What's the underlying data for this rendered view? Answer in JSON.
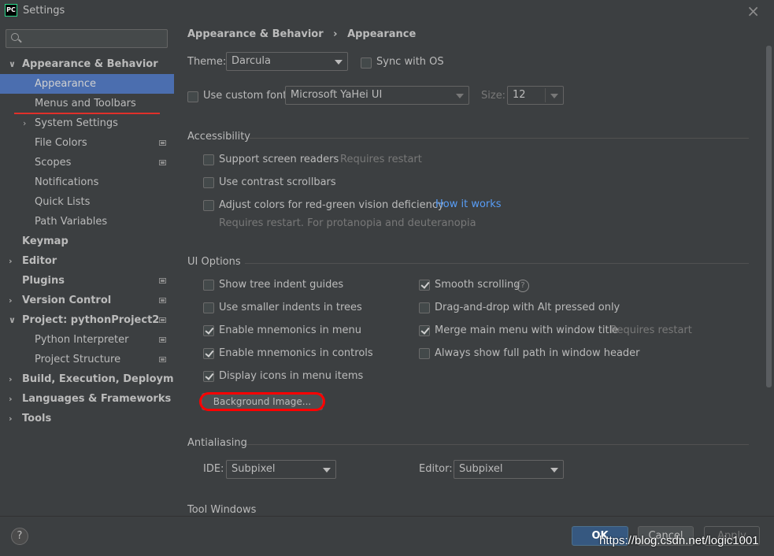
{
  "window": {
    "title": "Settings",
    "close_symbol": "×",
    "app_icon_text": "PC"
  },
  "sidebar": {
    "search_placeholder": "",
    "items": [
      {
        "label": "Appearance & Behavior",
        "expanded": true,
        "arrow": "∨"
      },
      {
        "label": "Appearance"
      },
      {
        "label": "Menus and Toolbars"
      },
      {
        "label": "System Settings",
        "arrow": "›"
      },
      {
        "label": "File Colors"
      },
      {
        "label": "Scopes"
      },
      {
        "label": "Notifications"
      },
      {
        "label": "Quick Lists"
      },
      {
        "label": "Path Variables"
      },
      {
        "label": "Keymap"
      },
      {
        "label": "Editor",
        "arrow": "›"
      },
      {
        "label": "Plugins"
      },
      {
        "label": "Version Control",
        "arrow": "›"
      },
      {
        "label": "Project: pythonProject2",
        "arrow": "∨"
      },
      {
        "label": "Python Interpreter"
      },
      {
        "label": "Project Structure"
      },
      {
        "label": "Build, Execution, Deployment",
        "arrow": "›"
      },
      {
        "label": "Languages & Frameworks",
        "arrow": "›"
      },
      {
        "label": "Tools",
        "arrow": "›"
      }
    ]
  },
  "breadcrumb": {
    "parent": "Appearance & Behavior",
    "separator": "›",
    "current": "Appearance"
  },
  "theme": {
    "label": "Theme:",
    "value": "Darcula",
    "sync_label": "Sync with OS",
    "sync_checked": false
  },
  "font": {
    "custom_label": "Use custom font:",
    "custom_checked": false,
    "family": "Microsoft YaHei UI",
    "size_label": "Size:",
    "size": "12"
  },
  "accessibility": {
    "title": "Accessibility",
    "screen_readers": "Support screen readers",
    "screen_readers_note": "Requires restart",
    "contrast_scrollbars": "Use contrast scrollbars",
    "color_deficiency": "Adjust colors for red-green vision deficiency",
    "how_it_works": "How it works",
    "deficiency_note": "Requires restart. For protanopia and deuteranopia"
  },
  "ui_options": {
    "title": "UI Options",
    "left": [
      {
        "label": "Show tree indent guides",
        "checked": false
      },
      {
        "label": "Use smaller indents in trees",
        "checked": false
      },
      {
        "label": "Enable mnemonics in menu",
        "checked": true
      },
      {
        "label": "Enable mnemonics in controls",
        "checked": true
      },
      {
        "label": "Display icons in menu items",
        "checked": true
      }
    ],
    "right": [
      {
        "label": "Smooth scrolling",
        "checked": true
      },
      {
        "label": "Drag-and-drop with Alt pressed only",
        "checked": false
      },
      {
        "label": "Merge main menu with window title",
        "checked": true
      },
      {
        "label": "Always show full path in window header",
        "checked": false
      }
    ],
    "merge_note": "Requires restart",
    "help_symbol": "?",
    "background_button": "Background Image..."
  },
  "antialiasing": {
    "title": "Antialiasing",
    "ide_label": "IDE:",
    "ide_value": "Subpixel",
    "editor_label": "Editor:",
    "editor_value": "Subpixel"
  },
  "tool_windows": {
    "title": "Tool Windows"
  },
  "footer": {
    "help": "?",
    "ok": "OK",
    "cancel": "Cancel",
    "apply": "Apply"
  },
  "watermark": "https://blog.csdn.net/logic1001",
  "colors": {
    "selection": "#4b6eaf",
    "link": "#589df6",
    "annotation_red": "#ff0000"
  }
}
